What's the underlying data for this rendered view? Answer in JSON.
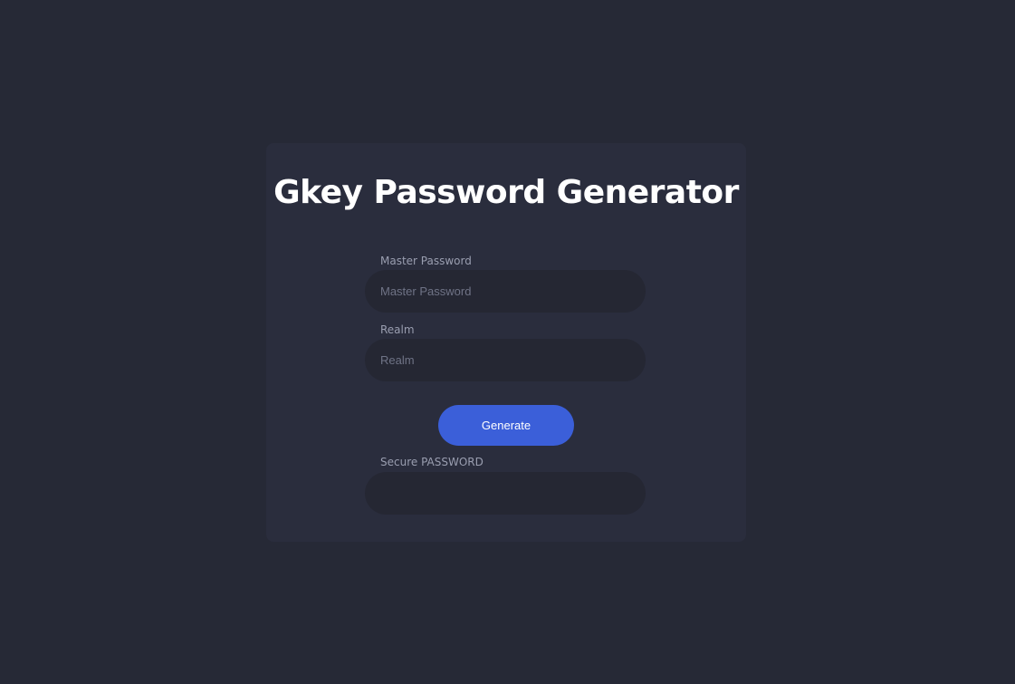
{
  "card": {
    "title": "Gkey Password Generator"
  },
  "form": {
    "master_password": {
      "label": "Master Password",
      "placeholder": "Master Password",
      "value": ""
    },
    "realm": {
      "label": "Realm",
      "placeholder": "Realm",
      "value": ""
    },
    "generate_label": "Generate",
    "secure_password": {
      "label": "Secure PASSWORD",
      "value": ""
    }
  },
  "colors": {
    "background": "#262936",
    "card": "#2a2d3d",
    "field": "#252733",
    "accent": "#3b5fd9"
  }
}
